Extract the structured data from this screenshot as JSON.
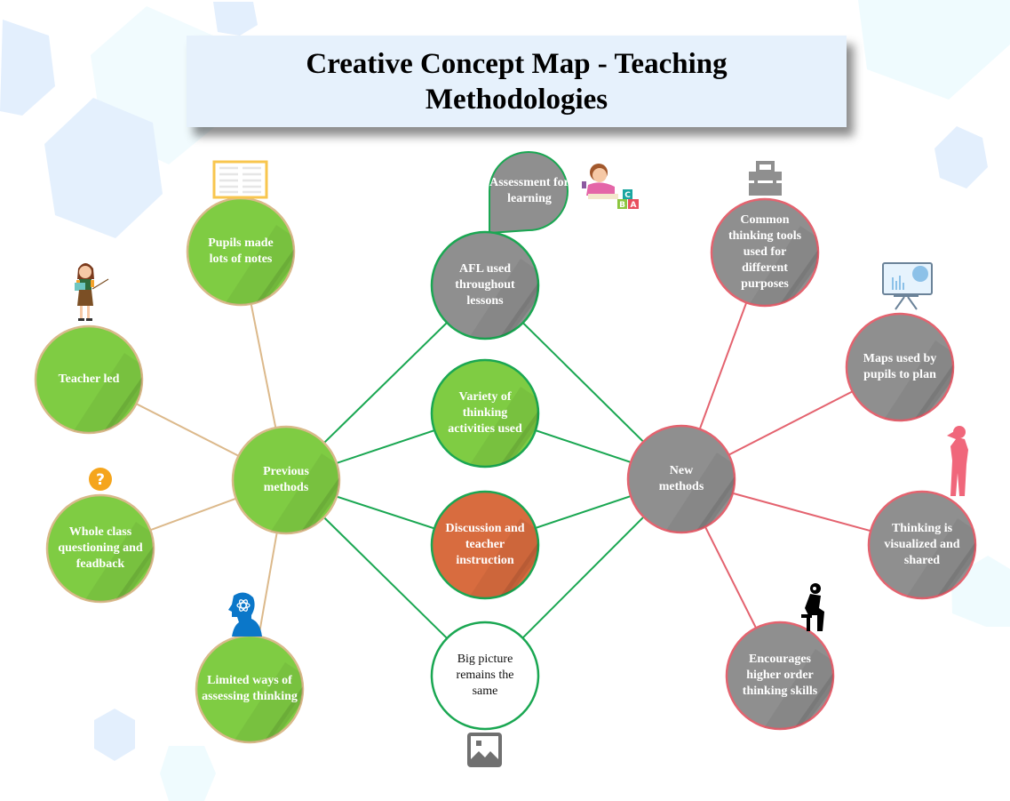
{
  "title": "Creative Concept Map - Teaching Methodologies",
  "colors": {
    "green_fill": "#7fcc43",
    "green_border": "#d9b98a",
    "gray_fill": "#8f8f8f",
    "red_border": "#e4636f",
    "green_line": "#1aa752",
    "tan_line": "#dcb98b",
    "orange_fill": "#d86c3f",
    "hex_blue": "#e3effd",
    "hex_cyan": "#effbfe"
  },
  "hubs": {
    "previous": {
      "label": "Previous methods"
    },
    "new": {
      "label": "New methods"
    }
  },
  "previous_branches": [
    {
      "label": "Teacher led",
      "icon": "teacher-icon"
    },
    {
      "label": "Pupils made lots of notes",
      "icon": "notebook-icon"
    },
    {
      "label": "Whole class questioning and feadback",
      "icon": "question-mark-icon"
    },
    {
      "label": "Limited ways of assessing thinking",
      "icon": "brain-head-icon"
    }
  ],
  "middle_nodes": [
    {
      "label": "AFL used throughout lessons",
      "style": "gray"
    },
    {
      "label": "Variety of thinking activities used",
      "style": "green"
    },
    {
      "label": "Discussion and teacher instruction",
      "style": "orange"
    },
    {
      "label": "Big picture remains the same",
      "style": "white"
    }
  ],
  "callout": {
    "label": "Assessment for learning",
    "icon": "girl-reading-abc-icon"
  },
  "image_placeholder": {
    "icon": "image-icon"
  },
  "new_branches": [
    {
      "label": "Common thinking tools used for different purposes",
      "icon": "toolbox-icon"
    },
    {
      "label": "Maps used by pupils to plan",
      "icon": "presentation-board-icon"
    },
    {
      "label": "Thinking is visualized and shared",
      "icon": "thinking-man-icon"
    },
    {
      "label": "Encourages higher order thinking skills",
      "icon": "thinker-sitting-icon"
    }
  ]
}
